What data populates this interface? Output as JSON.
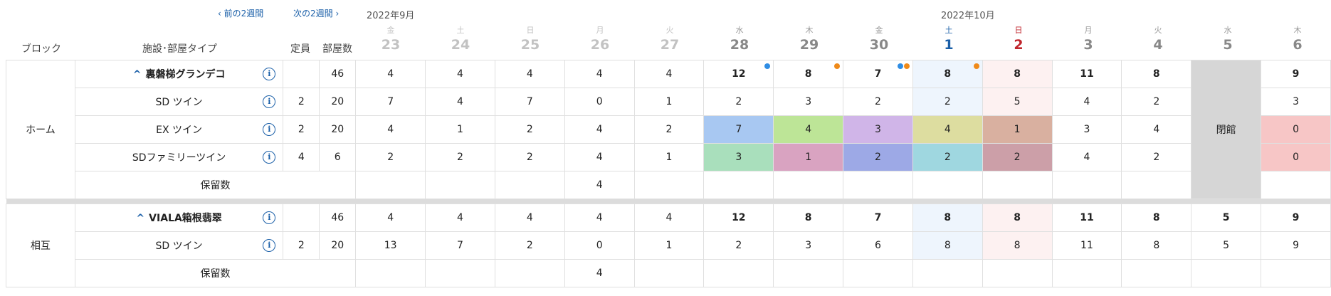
{
  "nav": {
    "prev": "‹ 前の2週間",
    "next": "次の2週間 ›"
  },
  "months": {
    "sep": "2022年9月",
    "oct": "2022年10月"
  },
  "headers": {
    "block": "ブロック",
    "facility": "施設･部屋タイプ",
    "capacity": "定員",
    "rooms": "部屋数"
  },
  "days": [
    {
      "dow": "金",
      "d": "23",
      "kind": "past"
    },
    {
      "dow": "土",
      "d": "24",
      "kind": "past"
    },
    {
      "dow": "日",
      "d": "25",
      "kind": "past"
    },
    {
      "dow": "月",
      "d": "26",
      "kind": "past"
    },
    {
      "dow": "火",
      "d": "27",
      "kind": "past"
    },
    {
      "dow": "水",
      "d": "28",
      "kind": "normal"
    },
    {
      "dow": "木",
      "d": "29",
      "kind": "normal"
    },
    {
      "dow": "金",
      "d": "30",
      "kind": "normal"
    },
    {
      "dow": "土",
      "d": "1",
      "kind": "sat"
    },
    {
      "dow": "日",
      "d": "2",
      "kind": "sun"
    },
    {
      "dow": "月",
      "d": "3",
      "kind": "normal"
    },
    {
      "dow": "火",
      "d": "4",
      "kind": "normal"
    },
    {
      "dow": "水",
      "d": "5",
      "kind": "normal"
    },
    {
      "dow": "木",
      "d": "6",
      "kind": "normal"
    }
  ],
  "blocks": [
    {
      "name": "ホーム",
      "facility": {
        "name": "裏磐梯グランデコ",
        "capacity": "",
        "rooms": "46",
        "values": [
          "4",
          "4",
          "4",
          "4",
          "4",
          "12",
          "8",
          "7",
          "8",
          "8",
          "11",
          "8",
          "",
          "9"
        ]
      },
      "rooms": [
        {
          "name": "SD ツイン",
          "capacity": "2",
          "rooms": "20",
          "values": [
            "7",
            "4",
            "7",
            "0",
            "1",
            "2",
            "3",
            "2",
            "2",
            "5",
            "4",
            "2",
            "",
            "3"
          ]
        },
        {
          "name": "EX ツイン",
          "capacity": "2",
          "rooms": "20",
          "values": [
            "4",
            "1",
            "2",
            "4",
            "2",
            "7",
            "4",
            "3",
            "4",
            "1",
            "3",
            "4",
            "",
            "0"
          ]
        },
        {
          "name": "SDファミリーツイン",
          "capacity": "4",
          "rooms": "6",
          "values": [
            "2",
            "2",
            "2",
            "4",
            "1",
            "3",
            "1",
            "2",
            "2",
            "2",
            "4",
            "2",
            "",
            "0"
          ]
        }
      ],
      "hold_label": "保留数",
      "hold_value": "4",
      "closed_label": "閉館"
    },
    {
      "name": "相互",
      "facility": {
        "name": "VIALA箱根翡翠",
        "capacity": "",
        "rooms": "46",
        "values": [
          "4",
          "4",
          "4",
          "4",
          "4",
          "12",
          "8",
          "7",
          "8",
          "8",
          "11",
          "8",
          "5",
          "9"
        ]
      },
      "rooms": [
        {
          "name": "SD ツイン",
          "capacity": "2",
          "rooms": "20",
          "values": [
            "13",
            "7",
            "2",
            "0",
            "1",
            "2",
            "3",
            "6",
            "8",
            "8",
            "11",
            "8",
            "5",
            "9"
          ]
        }
      ],
      "hold_label": "保留数",
      "hold_value": "4"
    }
  ],
  "colors": {
    "ex_28": "#a8c8f2",
    "ex_29": "#bde597",
    "ex_30": "#d0b5e8",
    "ex_1": "#dddda0",
    "ex_2": "#d9b0a0",
    "fam_28": "#a9dfbc",
    "fam_29": "#d9a3c1",
    "fam_30": "#9da9e6",
    "fam_1": "#9fd7e0",
    "fam_2": "#cc9fa8",
    "closed": "#d6d6d6",
    "zero": "#f7c6c6",
    "accent": "#1a5fa8"
  },
  "icons": {
    "info": "info-circle-icon",
    "collapse": "chevron-up-icon",
    "reserved_blue": "dot-icon",
    "reserved_orange": "dot-icon"
  }
}
